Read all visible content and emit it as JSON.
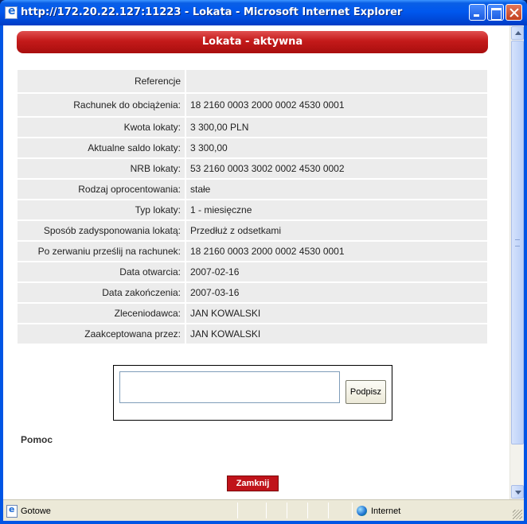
{
  "window": {
    "title": "http://172.20.22.127:11223 - Lokata - Microsoft Internet Explorer"
  },
  "page": {
    "header": "Lokata - aktywna",
    "details": [
      {
        "label": "Referencje",
        "value": ""
      },
      {
        "label": "Rachunek do obciążenia:",
        "value": "18 2160 0003 2000 0002 4530 0001"
      },
      {
        "label": "Kwota lokaty:",
        "value": "3 300,00 PLN"
      },
      {
        "label": "Aktualne saldo lokaty:",
        "value": "3 300,00"
      },
      {
        "label": "NRB lokaty:",
        "value": "53 2160 0003 3002 0002 4530 0002"
      },
      {
        "label": "Rodzaj oprocentowania:",
        "value": "stałe"
      },
      {
        "label": "Typ lokaty:",
        "value": "1 - miesięczne"
      },
      {
        "label": "Sposób zadysponowania lokatą:",
        "value": "Przedłuż z odsetkami"
      },
      {
        "label": "Po zerwaniu prześlij na rachunek:",
        "value": "18 2160 0003 2000 0002 4530 0001"
      },
      {
        "label": "Data otwarcia:",
        "value": "2007-02-16"
      },
      {
        "label": "Data zakończenia:",
        "value": "2007-03-16"
      },
      {
        "label": "Zleceniodawca:",
        "value": "JAN KOWALSKI"
      },
      {
        "label": "Zaakceptowana przez:",
        "value": "JAN KOWALSKI"
      }
    ],
    "sign": {
      "input_value": "",
      "button_label": "Podpisz"
    },
    "help_label": "Pomoc",
    "close_button_label": "Zamknij"
  },
  "statusbar": {
    "status_text": "Gotowe",
    "zone_text": "Internet"
  },
  "colors": {
    "header_red": "#c41a1a",
    "close_button_red": "#c0131a",
    "row_background": "#ececec",
    "titlebar_blue": "#0058ee"
  },
  "icons": [
    "ie-page-icon",
    "minimize-icon",
    "maximize-icon",
    "close-icon",
    "globe-icon"
  ]
}
